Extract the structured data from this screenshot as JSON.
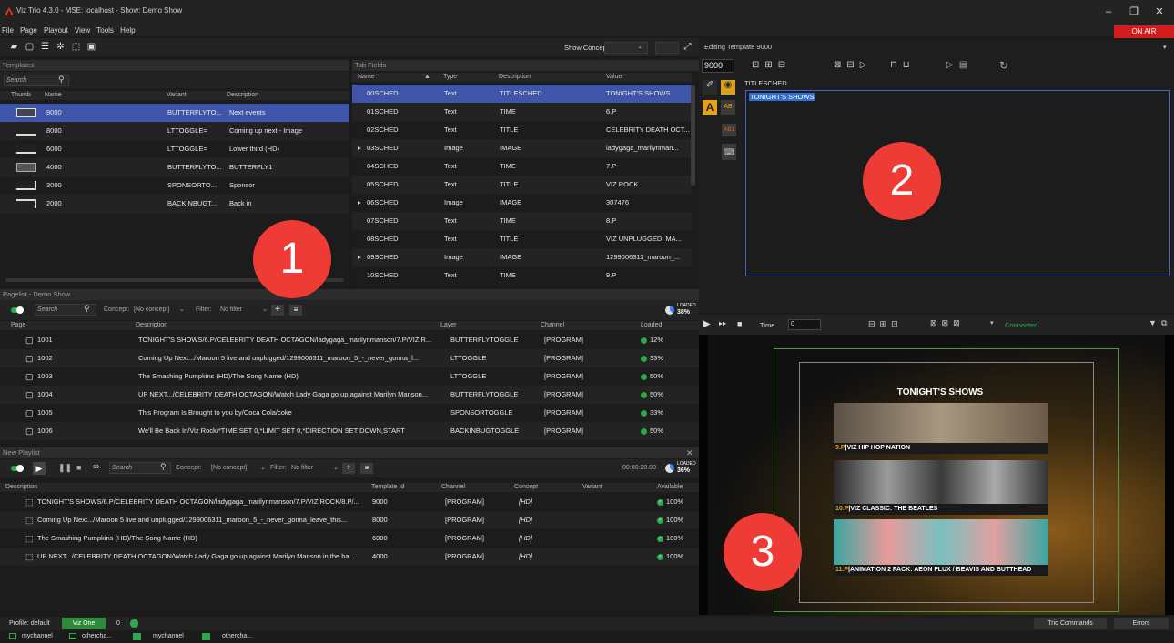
{
  "app": {
    "title": "Viz Trio 4.3.0 - MSE: localhost - Show: Demo Show",
    "on_air": "ON AIR"
  },
  "menu": [
    "File",
    "Page",
    "Playout",
    "View",
    "Tools",
    "Help"
  ],
  "toolbar": {
    "show_concept_label": "Show Concept:"
  },
  "templates": {
    "title": "Templates",
    "search_placeholder": "Search",
    "columns": [
      "Thumb",
      "Name",
      "Variant",
      "Description"
    ],
    "rows": [
      {
        "name": "9000",
        "variant": "BUTTERFLYTO...",
        "description": "Next events"
      },
      {
        "name": "8000",
        "variant": "LTTOGGLE=",
        "description": "Coming up next - Image"
      },
      {
        "name": "6000",
        "variant": "LTTOGGLE=",
        "description": "Lower third (HD)"
      },
      {
        "name": "4000",
        "variant": "BUTTERFLYTO...",
        "description": "BUTTERFLY1"
      },
      {
        "name": "3000",
        "variant": "SPONSORTO...",
        "description": "Sponsor"
      },
      {
        "name": "2000",
        "variant": "BACKINBUGT...",
        "description": "Back in"
      }
    ]
  },
  "tab_fields": {
    "title": "Tab Fields",
    "columns": [
      "Name",
      "Type",
      "Description",
      "Value"
    ],
    "rows": [
      {
        "name": "00SCHED",
        "type": "Text",
        "description": "TITLESCHED",
        "value": "TONIGHT'S SHOWS",
        "expand": ""
      },
      {
        "name": "01SCHED",
        "type": "Text",
        "description": "TIME",
        "value": "6.P",
        "expand": ""
      },
      {
        "name": "02SCHED",
        "type": "Text",
        "description": "TITLE",
        "value": "CELEBRITY DEATH OCT...",
        "expand": ""
      },
      {
        "name": "03SCHED",
        "type": "Image",
        "description": "IMAGE",
        "value": "ladygaga_marilynman...",
        "expand": "▸"
      },
      {
        "name": "04SCHED",
        "type": "Text",
        "description": "TIME",
        "value": "7.P",
        "expand": ""
      },
      {
        "name": "05SCHED",
        "type": "Text",
        "description": "TITLE",
        "value": "VIZ ROCK",
        "expand": ""
      },
      {
        "name": "06SCHED",
        "type": "Image",
        "description": "IMAGE",
        "value": "307476",
        "expand": "▸"
      },
      {
        "name": "07SCHED",
        "type": "Text",
        "description": "TIME",
        "value": "8.P",
        "expand": ""
      },
      {
        "name": "08SCHED",
        "type": "Text",
        "description": "TITLE",
        "value": "VIZ UNPLUGGED: MA...",
        "expand": ""
      },
      {
        "name": "09SCHED",
        "type": "Image",
        "description": "IMAGE",
        "value": "1299006311_maroon_...",
        "expand": "▸"
      },
      {
        "name": "10SCHED",
        "type": "Text",
        "description": "TIME",
        "value": "9.P",
        "expand": ""
      }
    ]
  },
  "editor": {
    "title": "Editing Template 9000",
    "template_number": "9000",
    "field_label": "TITLESCHED",
    "field_value": "TONIGHT'S SHOWS"
  },
  "pagelist": {
    "title": "Pagelist - Demo Show",
    "search_placeholder": "Search",
    "concept_label": "Concept:",
    "concept_value": "[No concept]",
    "filter_label": "Filter:",
    "filter_value": "No filter",
    "loaded_label": "LOADED",
    "loaded_pct": "38%",
    "columns": [
      "Page",
      "Description",
      "Layer",
      "Channel",
      "Loaded"
    ],
    "rows": [
      {
        "page": "1001",
        "description": "TONIGHT'S SHOWS/6.P/CELEBRITY DEATH OCTAGON/ladygaga_marilynmanson/7.P/VIZ R...",
        "layer": "BUTTERFLYTOGGLE",
        "channel": "[PROGRAM]",
        "loaded": "12%"
      },
      {
        "page": "1002",
        "description": "Coming Up Next.../Maroon 5 live and unplugged/1299006311_maroon_5_-_never_gonna_l...",
        "layer": "LTTOGGLE",
        "channel": "[PROGRAM]",
        "loaded": "33%"
      },
      {
        "page": "1003",
        "description": "The Smashing Pumpkins (HD)/The Song Name (HD)",
        "layer": "LTTOGGLE",
        "channel": "[PROGRAM]",
        "loaded": "50%"
      },
      {
        "page": "1004",
        "description": "UP NEXT.../CELEBRITY DEATH OCTAGON/Watch Lady Gaga go up against Marilyn Manson...",
        "layer": "BUTTERFLYTOGGLE",
        "channel": "[PROGRAM]",
        "loaded": "50%"
      },
      {
        "page": "1005",
        "description": "This Program Is  Brought to you by/Coca Cola/coke",
        "layer": "SPONSORTOGGLE",
        "channel": "[PROGRAM]",
        "loaded": "33%"
      },
      {
        "page": "1006",
        "description": "We'll Be Back In/Viz Rock/*TIME SET 0,*LIMIT SET 0,*DIRECTION SET DOWN,START",
        "layer": "BACKINBUGTOGGLE",
        "channel": "[PROGRAM]",
        "loaded": "50%"
      }
    ]
  },
  "playlist": {
    "title": "New Playlist",
    "search_placeholder": "Search",
    "concept_label": "Concept:",
    "concept_value": "[No concept]",
    "filter_label": "Filter:",
    "filter_value": "No filter",
    "timecode": "00:00:20.00",
    "loaded_label": "LOADED",
    "loaded_pct": "36%",
    "columns": [
      "Description",
      "Template Id",
      "Channel",
      "Concept",
      "Variant",
      "Available"
    ],
    "rows": [
      {
        "description": "TONIGHT'S SHOWS/6.P/CELEBRITY DEATH OCTAGON/ladygaga_marilynmanson/7.P/VIZ ROCK/8.P/...",
        "template": "9000",
        "channel": "[PROGRAM]",
        "concept": "[HD]",
        "variant": "",
        "available": "100%"
      },
      {
        "description": "Coming Up Next.../Maroon 5 live and unplugged/1299006311_maroon_5_-_never_gonna_leave_this...",
        "template": "8000",
        "channel": "[PROGRAM]",
        "concept": "[HD]",
        "variant": "",
        "available": "100%"
      },
      {
        "description": "The Smashing Pumpkins (HD)/The Song Name (HD)",
        "template": "6000",
        "channel": "[PROGRAM]",
        "concept": "[HD]",
        "variant": "",
        "available": "100%"
      },
      {
        "description": "UP NEXT.../CELEBRITY DEATH OCTAGON/Watch Lady Gaga go up against Marilyn Manson in the ba...",
        "template": "4000",
        "channel": "[PROGRAM]",
        "concept": "[HD]",
        "variant": "",
        "available": "100%"
      }
    ]
  },
  "preview": {
    "time_label": "Time",
    "time_value": "0",
    "status": "Connected",
    "header": "TONIGHT'S SHOWS",
    "items": [
      {
        "time": "9.P",
        "title": "VIZ HIP HOP NATION"
      },
      {
        "time": "10.P",
        "title": "VIZ CLASSIC: THE BEATLES"
      },
      {
        "time": "11.P",
        "title": "ANIMATION 2 PACK: AEON FLUX / BEAVIS AND BUTTHEAD"
      }
    ]
  },
  "callouts": [
    "1",
    "2",
    "3"
  ],
  "statusbar": {
    "profile": "Profile: default",
    "viz_one": "Viz One",
    "count": "0",
    "trio_commands": "Trio Commands",
    "errors": "Errors",
    "channels": [
      "mychannel",
      "othercha...",
      "mychannel",
      "othercha..."
    ]
  },
  "colors": {
    "accent": "#3f55a9",
    "on_air": "#d21d1d",
    "ok_green": "#2ea84c",
    "callout": "#ef3b36"
  }
}
